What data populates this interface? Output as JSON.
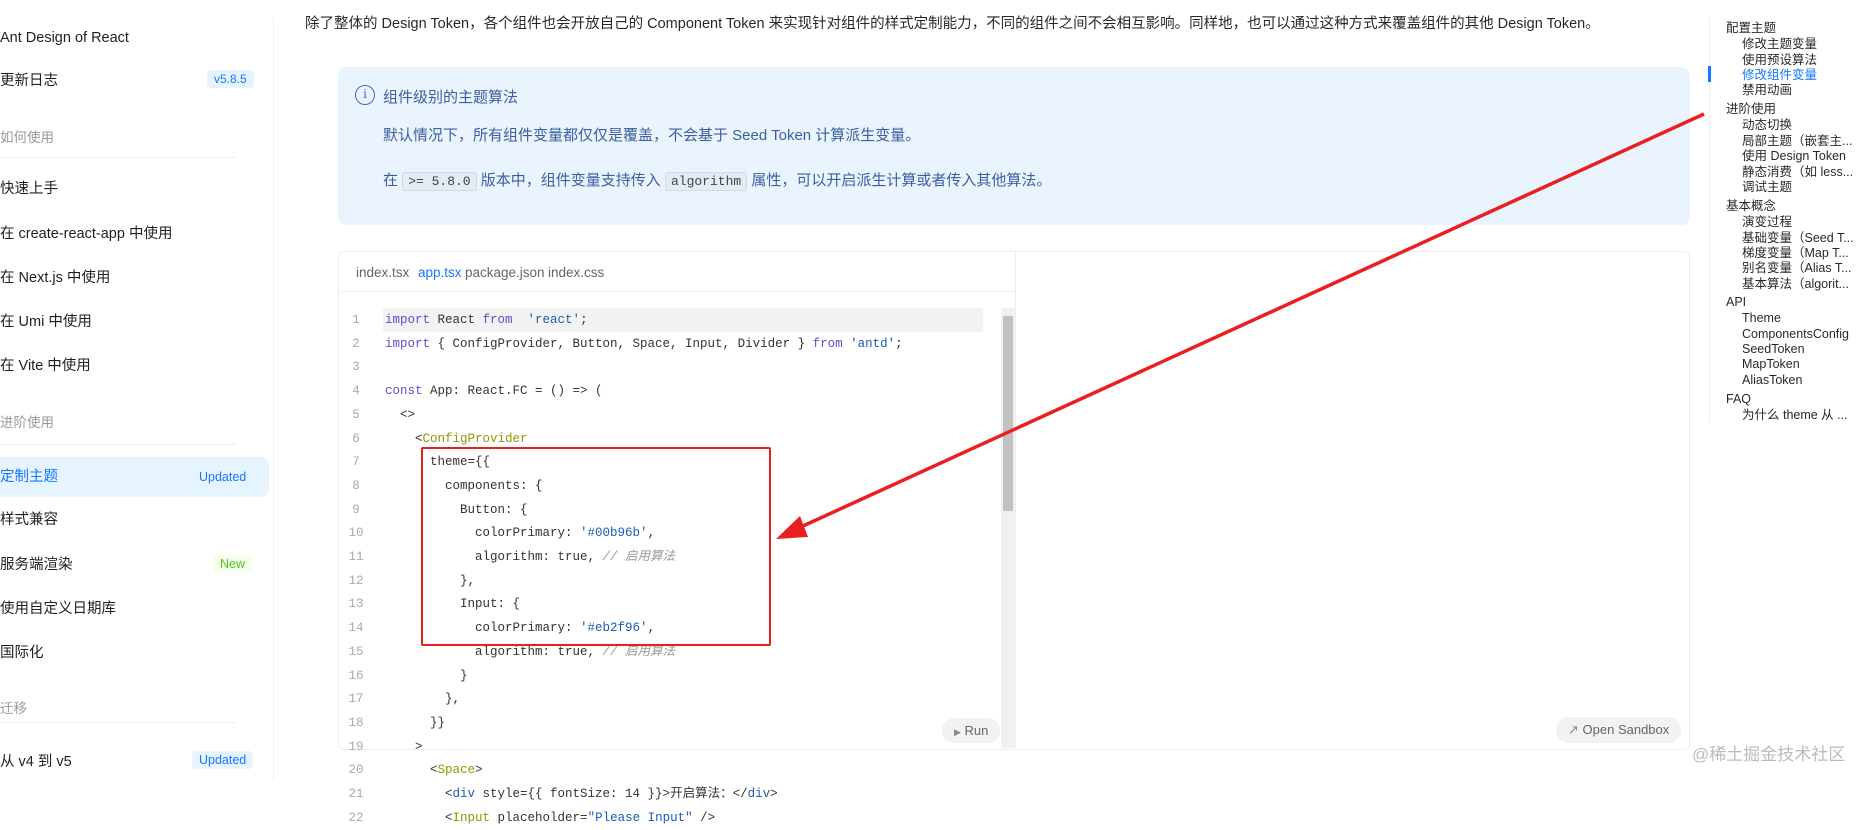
{
  "sidebar": {
    "title": "Ant Design of React",
    "changelog": "更新日志",
    "changelog_badge": "v5.8.5",
    "group_howto": "如何使用",
    "quick_start": "快速上手",
    "cra": "在 create-react-app 中使用",
    "next": "在 Next.js 中使用",
    "umi": "在 Umi 中使用",
    "vite": "在 Vite 中使用",
    "group_advanced": "进阶使用",
    "theme": "定制主题",
    "theme_badge": "Updated",
    "compat": "样式兼容",
    "ssr": "服务端渲染",
    "ssr_badge": "New",
    "date": "使用自定义日期库",
    "i18n": "国际化",
    "group_migrate": "迁移",
    "v4v5": "从 v4 到 v5",
    "v4v5_badge": "Updated"
  },
  "content": {
    "intro": "除了整体的 Design Token，各个组件也会开放自己的 Component Token 来实现针对组件的样式定制能力，不同的组件之间不会相互影响。同样地，也可以通过这种方式来覆盖组件的其他 Design Token。",
    "alert": {
      "icon": "i",
      "title": "组件级别的主题算法",
      "line1": "默认情况下，所有组件变量都仅仅是覆盖，不会基于 Seed Token 计算派生变量。",
      "line2_a": "在",
      "line2_code1": ">= 5.8.0",
      "line2_b": "版本中，组件变量支持传入",
      "line2_code2": "algorithm",
      "line2_c": "属性，可以开启派生计算或者传入其他算法。"
    },
    "tabs": [
      "index.tsx",
      "app.tsx",
      "package.json",
      "index.css"
    ],
    "active_tab": 1,
    "code": [
      [
        [
          "kw",
          "import"
        ],
        [
          "",
          "React "
        ],
        [
          "kw",
          "from"
        ],
        [
          "",
          ""
        ],
        [
          "str",
          " 'react'"
        ],
        [
          "",
          ";"
        ]
      ],
      [
        [
          "kw",
          "import"
        ],
        [
          "",
          "{ ConfigProvider, Button, Space, Input, Divider } "
        ],
        [
          "kw",
          "from"
        ],
        [
          "str",
          " 'antd'"
        ],
        [
          "",
          ";"
        ]
      ],
      [],
      [
        [
          "kw",
          "const"
        ],
        [
          "",
          " App: React.FC = () => ("
        ]
      ],
      [
        [
          "",
          "  <>"
        ]
      ],
      [
        [
          "",
          "    <"
        ],
        [
          "tag",
          "ConfigProvider"
        ]
      ],
      [
        [
          "",
          "      theme={{"
        ]
      ],
      [
        [
          "",
          "        components: {"
        ]
      ],
      [
        [
          "",
          "          Button: {"
        ]
      ],
      [
        [
          "",
          "            colorPrimary: "
        ],
        [
          "str",
          "'#00b96b'"
        ],
        [
          "",
          ","
        ]
      ],
      [
        [
          "",
          "            algorithm: true, "
        ],
        [
          "cm",
          "// 启用算法"
        ]
      ],
      [
        [
          "",
          "          },"
        ]
      ],
      [
        [
          "",
          "          Input: {"
        ]
      ],
      [
        [
          "",
          "            colorPrimary: "
        ],
        [
          "str",
          "'#eb2f96'"
        ],
        [
          "",
          ","
        ]
      ],
      [
        [
          "",
          "            algorithm: true, "
        ],
        [
          "cm",
          "// 启用算法"
        ]
      ],
      [
        [
          "",
          "          }"
        ]
      ],
      [
        [
          "",
          "        },"
        ]
      ],
      [
        [
          "",
          "      }}"
        ]
      ],
      [
        [
          "",
          "    >"
        ]
      ],
      [
        [
          "",
          "      <"
        ],
        [
          "tag",
          "Space"
        ],
        [
          "",
          ">"
        ]
      ],
      [
        [
          "",
          "        <"
        ],
        [
          "tagb",
          "div"
        ],
        [
          "",
          " style={{ fontSize: 14 }}>开启算法：</"
        ],
        [
          "tagb",
          "div"
        ],
        [
          "",
          ">"
        ]
      ],
      [
        [
          "",
          "        <"
        ],
        [
          "tag",
          "Input"
        ],
        [
          "",
          " placeholder="
        ],
        [
          "str",
          "\"Please Input\""
        ],
        [
          "",
          " />"
        ]
      ]
    ],
    "run": "Run",
    "open_sandbox": "Open Sandbox"
  },
  "toc": [
    {
      "label": "配置主题",
      "level": "h"
    },
    {
      "label": "修改主题变量",
      "level": "s"
    },
    {
      "label": "使用预设算法",
      "level": "s"
    },
    {
      "label": "修改组件变量",
      "level": "s",
      "active": true
    },
    {
      "label": "禁用动画",
      "level": "s"
    },
    {
      "label": "进阶使用",
      "level": "h"
    },
    {
      "label": "动态切换",
      "level": "s"
    },
    {
      "label": "局部主题（嵌套主...",
      "level": "s"
    },
    {
      "label": "使用 Design Token",
      "level": "s"
    },
    {
      "label": "静态消费（如 less...",
      "level": "s"
    },
    {
      "label": "调试主题",
      "level": "s"
    },
    {
      "label": "基本概念",
      "level": "h"
    },
    {
      "label": "演变过程",
      "level": "s"
    },
    {
      "label": "基础变量（Seed T...",
      "level": "s"
    },
    {
      "label": "梯度变量（Map T...",
      "level": "s"
    },
    {
      "label": "别名变量（Alias T...",
      "level": "s"
    },
    {
      "label": "基本算法（algorit...",
      "level": "s"
    },
    {
      "label": "API",
      "level": "h"
    },
    {
      "label": "Theme",
      "level": "s"
    },
    {
      "label": "ComponentsConfig",
      "level": "s"
    },
    {
      "label": "SeedToken",
      "level": "s"
    },
    {
      "label": "MapToken",
      "level": "s"
    },
    {
      "label": "AliasToken",
      "level": "s"
    },
    {
      "label": "FAQ",
      "level": "h"
    },
    {
      "label": "为什么 theme 从 ...",
      "level": "s"
    }
  ],
  "watermark": "@稀土掘金技术社区",
  "colors": {
    "primary": "#1677ff",
    "annotation": "#ea1f1f",
    "alert_bg": "#eaf4ff"
  }
}
